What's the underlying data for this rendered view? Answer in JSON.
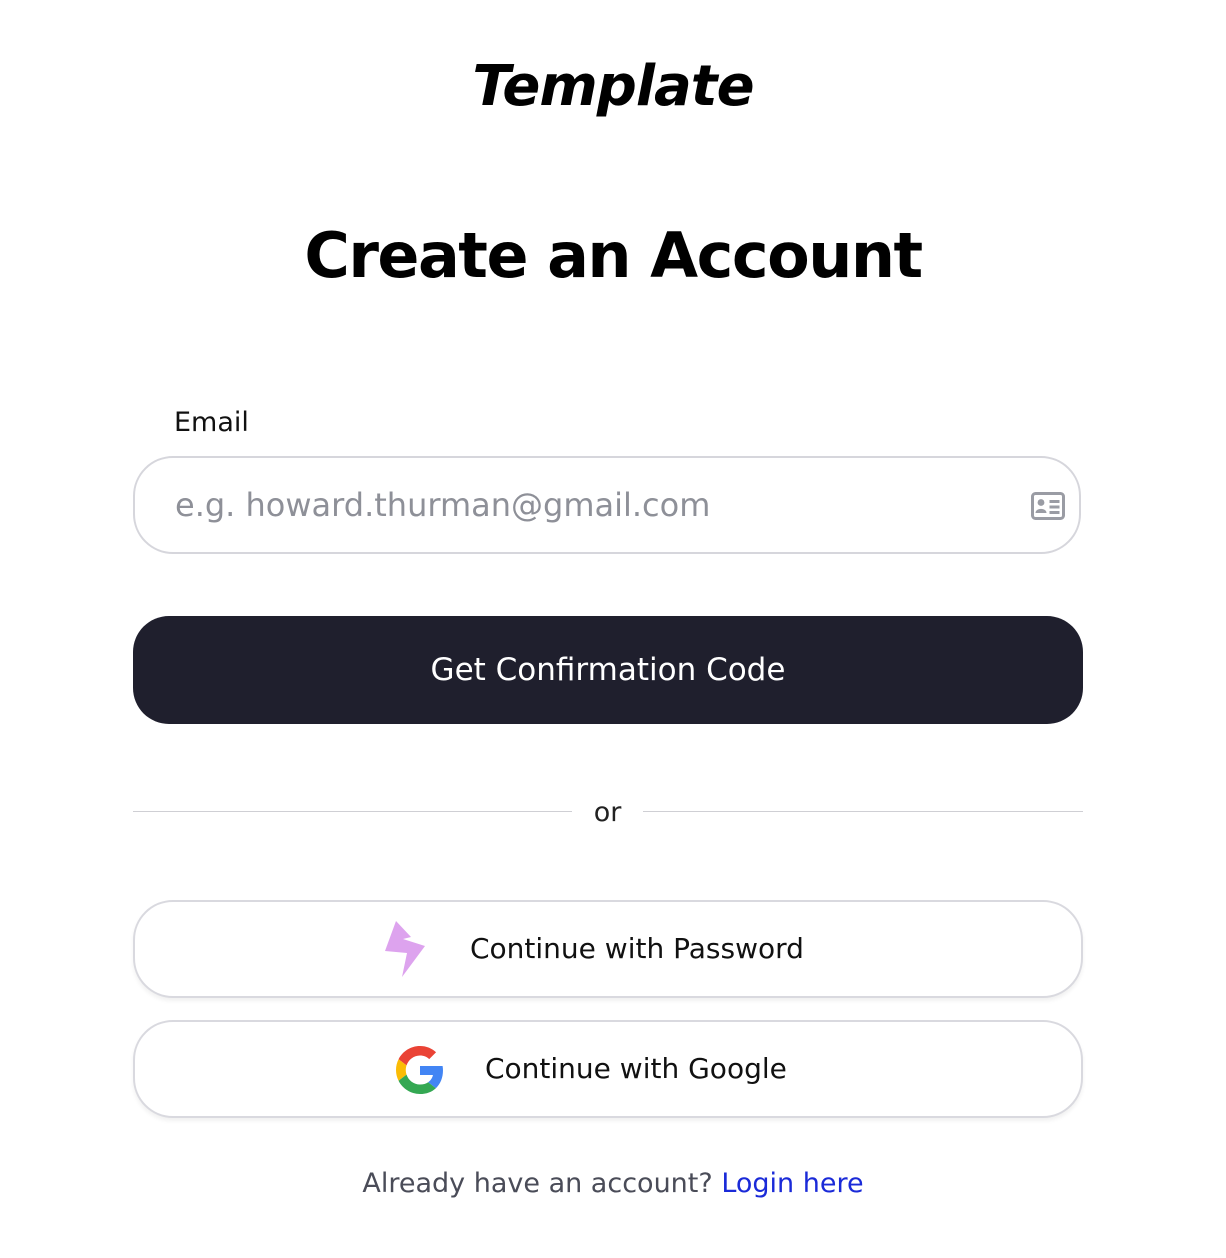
{
  "brand": {
    "logo_text": "Template"
  },
  "page": {
    "title": "Create an Account"
  },
  "form": {
    "email_label": "Email",
    "email_placeholder": "e.g. howard.thurman@gmail.com",
    "email_value": "",
    "email_icon": "contact-card-icon",
    "submit_label": "Get Confirmation Code"
  },
  "divider": {
    "text": "or"
  },
  "alternatives": {
    "password_label": "Continue with Password",
    "password_icon": "lightning-bolt-icon",
    "google_label": "Continue with Google",
    "google_icon": "google-logo-icon"
  },
  "footer": {
    "prompt": "Already have an account?",
    "link_label": "Login here"
  },
  "colors": {
    "primary_button_bg": "#1f1f2d",
    "link": "#1a2ad8",
    "bolt": "#dda3ee"
  }
}
